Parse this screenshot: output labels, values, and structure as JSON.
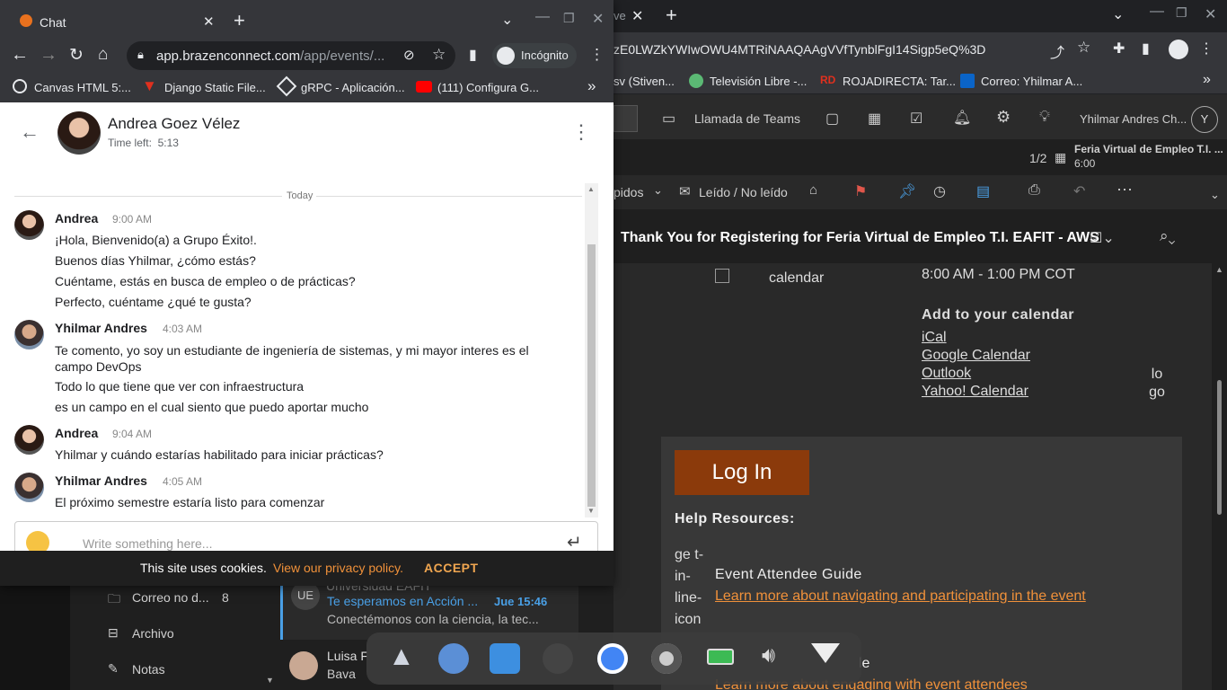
{
  "back_window": {
    "tab_title_fragment": "ve",
    "url_fragment": "zE0LWZkYWIwOWU4MTRiNAAQAAgVVfTynblFgI14Sigp5eQ%3D",
    "bookmarks": [
      "sv (Stiven...",
      "Televisión Libre -...",
      "ROJADIRECTA: Tar...",
      "Correo: Yhilmar A..."
    ],
    "outlook": {
      "teams_call": "Llamada de Teams",
      "user_name": "Yhilmar Andres Ch...",
      "user_initial": "Y",
      "reminder_count": "1/2",
      "reminder_title": "Feria Virtual de Empleo T.I. ...",
      "reminder_time": "6:00",
      "toolbar_rapidos": "pidos",
      "toolbar_read": "Leído / No leído",
      "subject": "Thank You for Registering for Feria Virtual de Empleo T.I. EAFIT - AWS"
    },
    "mail": {
      "calendar_alt": "calendar",
      "time_range": "8:00 AM - 1:00 PM COT",
      "add_calendar_title": "Add to your calendar",
      "calendar_links": [
        "iCal",
        "Google Calendar",
        "Outlook",
        "Yahoo! Calendar"
      ],
      "logo_alt": "lo go",
      "login_button": "Log In",
      "help_title": "Help Resources:",
      "icon_alt": "ge t-in- line- icon",
      "guide_title": "Event Attendee Guide",
      "guide_link": "Learn more about navigating and participating in the event",
      "guide2_title_fragment": "le",
      "guide2_link": "Learn more about engaging with event attendees"
    },
    "folders": [
      {
        "label": "Correo no d...",
        "count": "8"
      },
      {
        "label": "Archivo",
        "count": ""
      },
      {
        "label": "Notas",
        "count": ""
      }
    ],
    "mail_list": [
      {
        "initials": "UE",
        "sender_fragment": "Universidad EAFIT",
        "subject": "Te esperamos en Acción ...",
        "date": "Jue 15:46",
        "preview": "Conectémonos con la ciencia, la tec..."
      },
      {
        "initials": "",
        "sender_fragment": "Luisa F",
        "subject": "Bava",
        "date": "",
        "preview": ""
      }
    ]
  },
  "front_window": {
    "tab_title": "Chat",
    "url_domain": "app.brazenconnect.com",
    "url_path": "/app/events/...",
    "incognito_label": "Incógnito",
    "bookmarks": [
      "Canvas HTML 5:...",
      "Django Static File...",
      "gRPC - Aplicación...",
      "(111) Configura G..."
    ],
    "chat": {
      "contact_name": "Andrea Goez Vélez",
      "time_left": "Time left:  5:13",
      "divider": "Today",
      "composer_placeholder": "Write something here...",
      "messages": [
        {
          "author": "Andrea",
          "time": "9:00 AM",
          "lines": [
            "¡Hola, Bienvenido(a) a Grupo Éxito!.",
            "Buenos días Yhilmar, ¿cómo estás?",
            "Cuéntame, estás en busca de empleo o de prácticas?",
            "Perfecto, cuéntame ¿qué te gusta?"
          ]
        },
        {
          "author": "Yhilmar Andres",
          "time": "4:03 AM",
          "lines": [
            "Te comento, yo soy un estudiante de ingeniería de sistemas, y mi mayor interes es el campo DevOps",
            "Todo lo que tiene que ver con infraestructura",
            "es un campo en el cual siento que puedo aportar mucho"
          ]
        },
        {
          "author": "Andrea",
          "time": "9:04 AM",
          "lines": [
            "Yhilmar y cuándo estarías habilitado para iniciar prácticas?"
          ]
        },
        {
          "author": "Yhilmar Andres",
          "time": "4:05 AM",
          "lines": [
            "El próximo semestre estaría listo para comenzar"
          ]
        }
      ]
    },
    "cookie": {
      "text": "This site uses cookies.",
      "link": "View our privacy policy.",
      "accept": "ACCEPT"
    }
  },
  "colors": {
    "orange_link": "#f0913a",
    "accept": "#f0a650",
    "login_bg": "#8b3a0b",
    "outlook_accent": "#4aa0e6"
  }
}
